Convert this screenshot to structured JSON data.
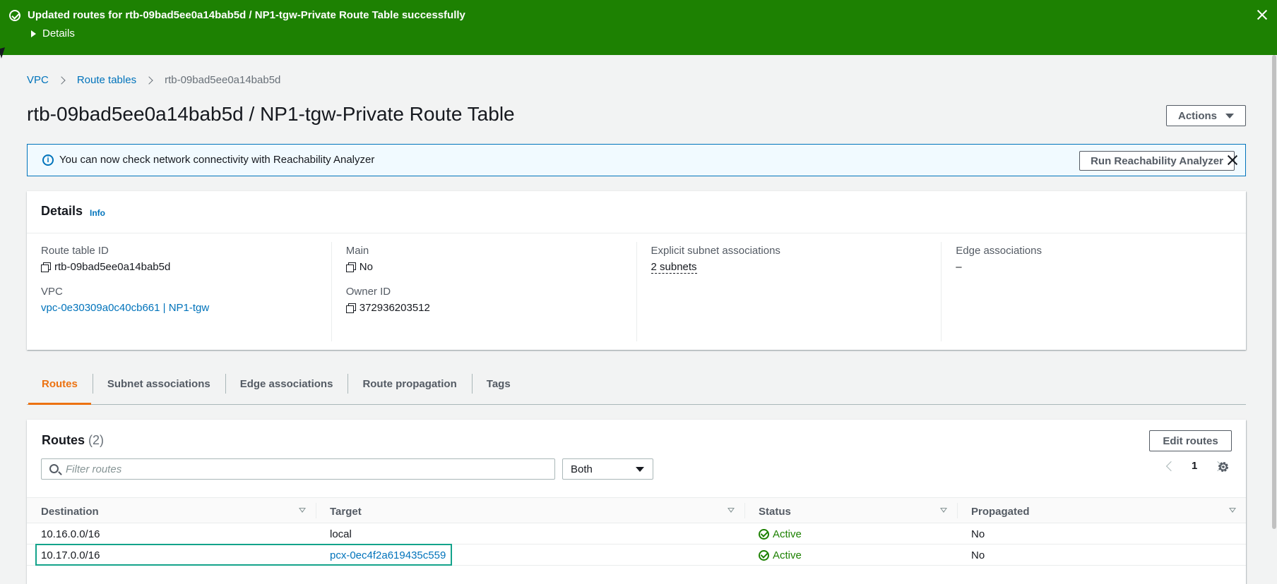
{
  "flash": {
    "message": "Updated routes for rtb-09bad5ee0a14bab5d / NP1-tgw-Private Route Table successfully",
    "details_label": "Details",
    "color": "#1d8102"
  },
  "breadcrumb": {
    "items": [
      "VPC",
      "Route tables"
    ],
    "current": "rtb-09bad5ee0a14bab5d"
  },
  "page": {
    "title": "rtb-09bad5ee0a14bab5d / NP1-tgw-Private Route Table",
    "actions_label": "Actions"
  },
  "info_alert": {
    "text": "You can now check network connectivity with Reachability Analyzer",
    "button_label": "Run Reachability Analyzer"
  },
  "details": {
    "title": "Details",
    "info_link": "Info",
    "route_table_id_label": "Route table ID",
    "route_table_id": "rtb-09bad5ee0a14bab5d",
    "vpc_label": "VPC",
    "vpc": "vpc-0e30309a0c40cb661 | NP1-tgw",
    "main_label": "Main",
    "main": "No",
    "owner_id_label": "Owner ID",
    "owner_id": "372936203512",
    "explicit_subnet_label": "Explicit subnet associations",
    "explicit_subnet": "2 subnets",
    "edge_associations_label": "Edge associations",
    "edge_associations": "–"
  },
  "tabs": [
    "Routes",
    "Subnet associations",
    "Edge associations",
    "Route propagation",
    "Tags"
  ],
  "routes": {
    "title": "Routes",
    "count": "(2)",
    "edit_label": "Edit routes",
    "filter_placeholder": "Filter routes",
    "filter_select": "Both",
    "page_number": "1",
    "columns": [
      "Destination",
      "Target",
      "Status",
      "Propagated"
    ],
    "rows": [
      {
        "destination": "10.16.0.0/16",
        "target": "local",
        "status": "Active",
        "propagated": "No"
      },
      {
        "destination": "10.17.0.0/16",
        "target": "pcx-0ec4f2a619435c559",
        "status": "Active",
        "propagated": "No"
      }
    ]
  },
  "colors": {
    "accent": "#ec7211",
    "link": "#0073bb",
    "success": "#1d8102",
    "highlight": "#14a38b"
  }
}
